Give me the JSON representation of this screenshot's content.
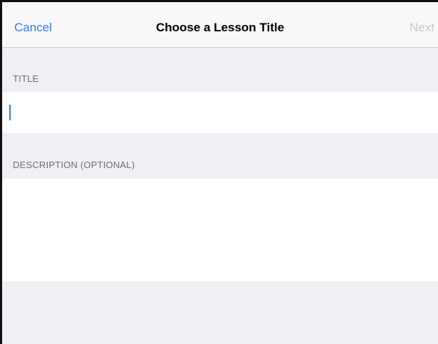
{
  "navbar": {
    "cancel_label": "Cancel",
    "title": "Choose a Lesson Title",
    "next_label": "Next"
  },
  "form": {
    "title_label": "TITLE",
    "title_value": "",
    "description_label": "DESCRIPTION (OPTIONAL)",
    "description_value": ""
  },
  "colors": {
    "accent": "#2f7cf6",
    "disabled": "#c7c7cc",
    "background": "#efeff4"
  }
}
